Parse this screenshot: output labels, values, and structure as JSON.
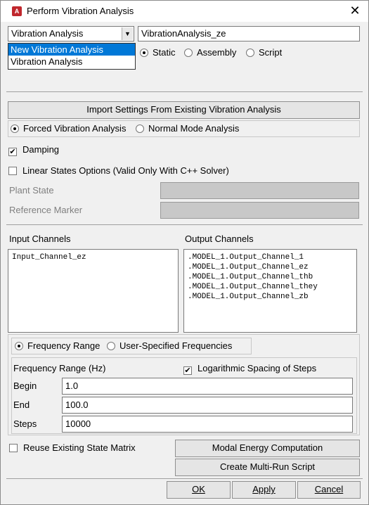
{
  "window": {
    "title": "Perform Vibration Analysis",
    "icon_letter": "A"
  },
  "analysis_select": {
    "value": "Vibration Analysis",
    "options": [
      "New Vibration Analysis",
      "Vibration Analysis"
    ]
  },
  "analysis_name": {
    "value": "VibrationAnalysis_ze"
  },
  "operating_point": {
    "options": [
      "Static",
      "Assembly",
      "Script"
    ],
    "selected": "Static"
  },
  "import_button": "Import Settings From Existing Vibration Analysis",
  "analysis_type": {
    "options": [
      "Forced Vibration Analysis",
      "Normal Mode Analysis"
    ],
    "selected": "Forced Vibration Analysis"
  },
  "damping": {
    "label": "Damping",
    "checked": true
  },
  "linear_states": {
    "label": "Linear States Options (Valid Only With C++ Solver)",
    "checked": false
  },
  "plant_state_label": "Plant State",
  "reference_marker_label": "Reference Marker",
  "input_channels": {
    "label": "Input Channels",
    "items": [
      "Input_Channel_ez"
    ]
  },
  "output_channels": {
    "label": "Output Channels",
    "items": [
      ".MODEL_1.Output_Channel_1",
      ".MODEL_1.Output_Channel_ez",
      ".MODEL_1.Output_Channel_thb",
      ".MODEL_1.Output_Channel_they",
      ".MODEL_1.Output_Channel_zb"
    ]
  },
  "frequency_mode": {
    "options": [
      "Frequency Range",
      "User-Specified Frequencies"
    ],
    "selected": "Frequency Range"
  },
  "frequency": {
    "range_label": "Frequency Range (Hz)",
    "log_label": "Logarithmic Spacing of Steps",
    "log_checked": true,
    "begin_label": "Begin",
    "begin_value": "1.0",
    "end_label": "End",
    "end_value": "100.0",
    "steps_label": "Steps",
    "steps_value": "10000"
  },
  "reuse_state_matrix": {
    "label": "Reuse Existing State Matrix",
    "checked": false
  },
  "modal_energy_button": "Modal Energy Computation",
  "multi_run_button": "Create Multi-Run Script",
  "ok_button": "OK",
  "apply_button": "Apply",
  "cancel_button": "Cancel"
}
